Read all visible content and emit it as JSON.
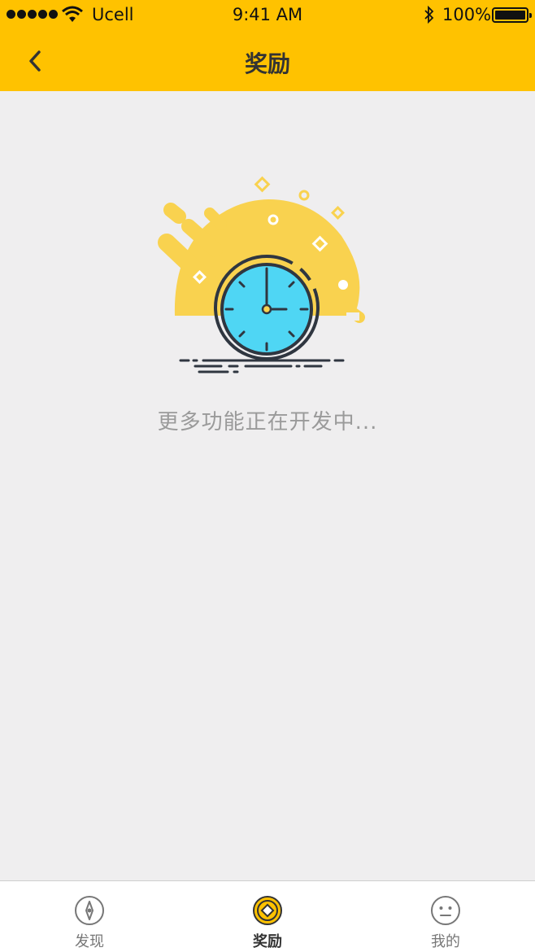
{
  "status_bar": {
    "carrier": "Ucell",
    "time": "9:41 AM",
    "battery": "100%",
    "icons": [
      "signal-dots",
      "wifi-icon",
      "bluetooth-icon",
      "battery-icon"
    ]
  },
  "nav": {
    "title": "奖励",
    "back_icon": "chevron-left-icon"
  },
  "main": {
    "illustration": "clock-illustration",
    "message": "更多功能正在开发中..."
  },
  "tab_bar": {
    "tabs": [
      {
        "label": "发现",
        "icon": "compass-icon",
        "active": false
      },
      {
        "label": "奖励",
        "icon": "reward-coin-icon",
        "active": true
      },
      {
        "label": "我的",
        "icon": "face-icon",
        "active": false
      }
    ]
  },
  "colors": {
    "brand_yellow": "#ffc200",
    "illustration_yellow": "#f9d24f",
    "clock_face": "#4fd6f4",
    "line_dark": "#2f3640",
    "background": "#efeeef"
  }
}
